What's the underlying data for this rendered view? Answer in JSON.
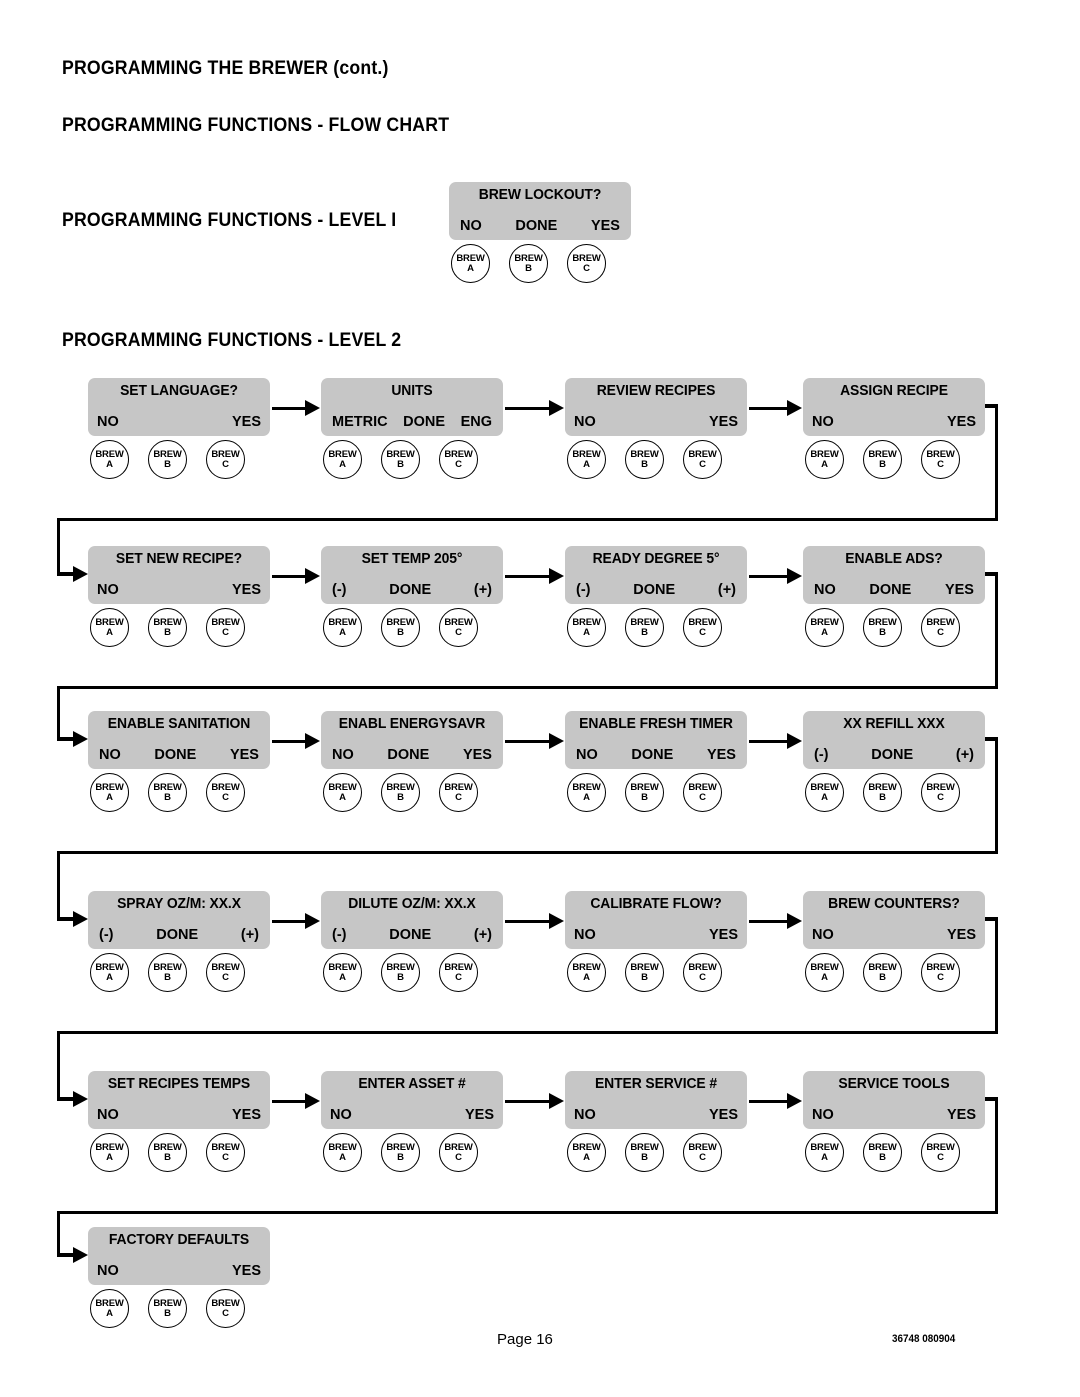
{
  "headings": {
    "title": "PROGRAMMING THE BREWER (cont.)",
    "flow_chart": "PROGRAMMING FUNCTIONS - FLOW CHART",
    "level1": "PROGRAMMING FUNCTIONS - LEVEL  I",
    "level2": "PROGRAMMING FUNCTIONS - LEVEL  2"
  },
  "brew_buttons": [
    {
      "line1": "BREW",
      "line2": "A"
    },
    {
      "line1": "BREW",
      "line2": "B"
    },
    {
      "line1": "BREW",
      "line2": "C"
    }
  ],
  "level1": {
    "nodes": [
      {
        "title": "BREW LOCKOUT?",
        "options": [
          "NO",
          "DONE",
          "YES"
        ]
      }
    ]
  },
  "level2": {
    "rows": [
      [
        {
          "title": "SET LANGUAGE?",
          "options": [
            "NO",
            "YES"
          ]
        },
        {
          "title": "UNITS",
          "options": [
            "METRIC",
            "DONE",
            "ENG"
          ]
        },
        {
          "title": "REVIEW RECIPES",
          "options": [
            "NO",
            "YES"
          ]
        },
        {
          "title": "ASSIGN RECIPE",
          "options": [
            "NO",
            "YES"
          ]
        }
      ],
      [
        {
          "title": "SET NEW RECIPE?",
          "options": [
            "NO",
            "YES"
          ]
        },
        {
          "title": "SET TEMP  205°",
          "options": [
            "(-)",
            "DONE",
            "(+)"
          ]
        },
        {
          "title": "READY DEGREE 5°",
          "options": [
            "(-)",
            "DONE",
            "(+)"
          ]
        },
        {
          "title": "ENABLE ADS?",
          "options": [
            "NO",
            "DONE",
            "YES"
          ]
        }
      ],
      [
        {
          "title": "ENABLE SANITATION",
          "options": [
            "NO",
            "DONE",
            "YES"
          ]
        },
        {
          "title": "ENABL ENERGYSAVR",
          "options": [
            "NO",
            "DONE",
            "YES"
          ]
        },
        {
          "title": "ENABLE FRESH TIMER",
          "options": [
            "NO",
            "DONE",
            "YES"
          ]
        },
        {
          "title": "XX      REFILL      XXX",
          "options": [
            "(-)",
            "DONE",
            "(+)"
          ]
        }
      ],
      [
        {
          "title": "SPRAY OZ/M:  XX.X",
          "options": [
            "(-)",
            "DONE",
            "(+)"
          ]
        },
        {
          "title": "DILUTE OZ/M:  XX.X",
          "options": [
            "(-)",
            "DONE",
            "(+)"
          ]
        },
        {
          "title": "CALIBRATE FLOW?",
          "options": [
            "NO",
            "YES"
          ]
        },
        {
          "title": "BREW COUNTERS?",
          "options": [
            "NO",
            "YES"
          ]
        }
      ],
      [
        {
          "title": "SET RECIPES TEMPS",
          "options": [
            "NO",
            "YES"
          ]
        },
        {
          "title": "ENTER ASSET #",
          "options": [
            "NO",
            "YES"
          ]
        },
        {
          "title": "ENTER SERVICE #",
          "options": [
            "NO",
            "YES"
          ]
        },
        {
          "title": "SERVICE TOOLS",
          "options": [
            "NO",
            "YES"
          ]
        }
      ],
      [
        {
          "title": "FACTORY DEFAULTS",
          "options": [
            "NO",
            "YES"
          ]
        }
      ]
    ]
  },
  "footer": {
    "page": "Page 16",
    "code": "36748 080904"
  },
  "colors": {
    "box_fill": "#c6c6c6",
    "line": "#000000",
    "background": "#ffffff"
  }
}
